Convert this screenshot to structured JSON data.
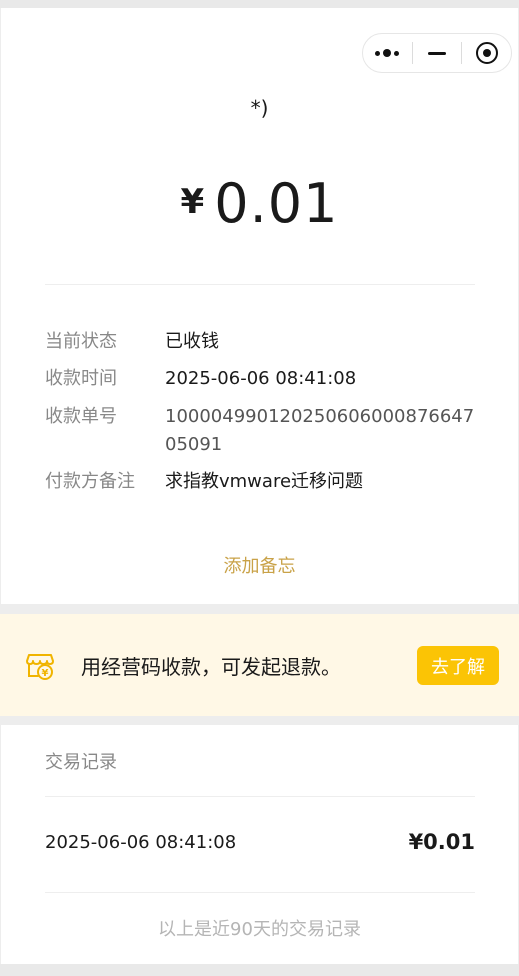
{
  "header": {
    "payer_name": "*)",
    "currency_symbol": "¥",
    "amount": "0.01"
  },
  "details": [
    {
      "label": "当前状态",
      "value": "已收钱"
    },
    {
      "label": "收款时间",
      "value": "2025-06-06 08:41:08"
    },
    {
      "label": "收款单号",
      "value": "1000049901202506060008766470​5091"
    },
    {
      "label": "付款方备注",
      "value": "求指教vmware迁移问题"
    }
  ],
  "add_note_label": "添加备忘",
  "banner": {
    "text": "用经营码收款，可发起退款。",
    "button_label": "去了解",
    "icon": "shop-refund-icon",
    "accent_color": "#fbc405"
  },
  "records": {
    "title": "交易记录",
    "items": [
      {
        "time": "2025-06-06 08:41:08",
        "amount": "¥0.01"
      }
    ],
    "footer": "以上是近90天的交易记录"
  },
  "capsule": {
    "more_icon": "more-dots-icon",
    "minimize_icon": "minimize-icon",
    "close_icon": "target-circle-icon"
  }
}
